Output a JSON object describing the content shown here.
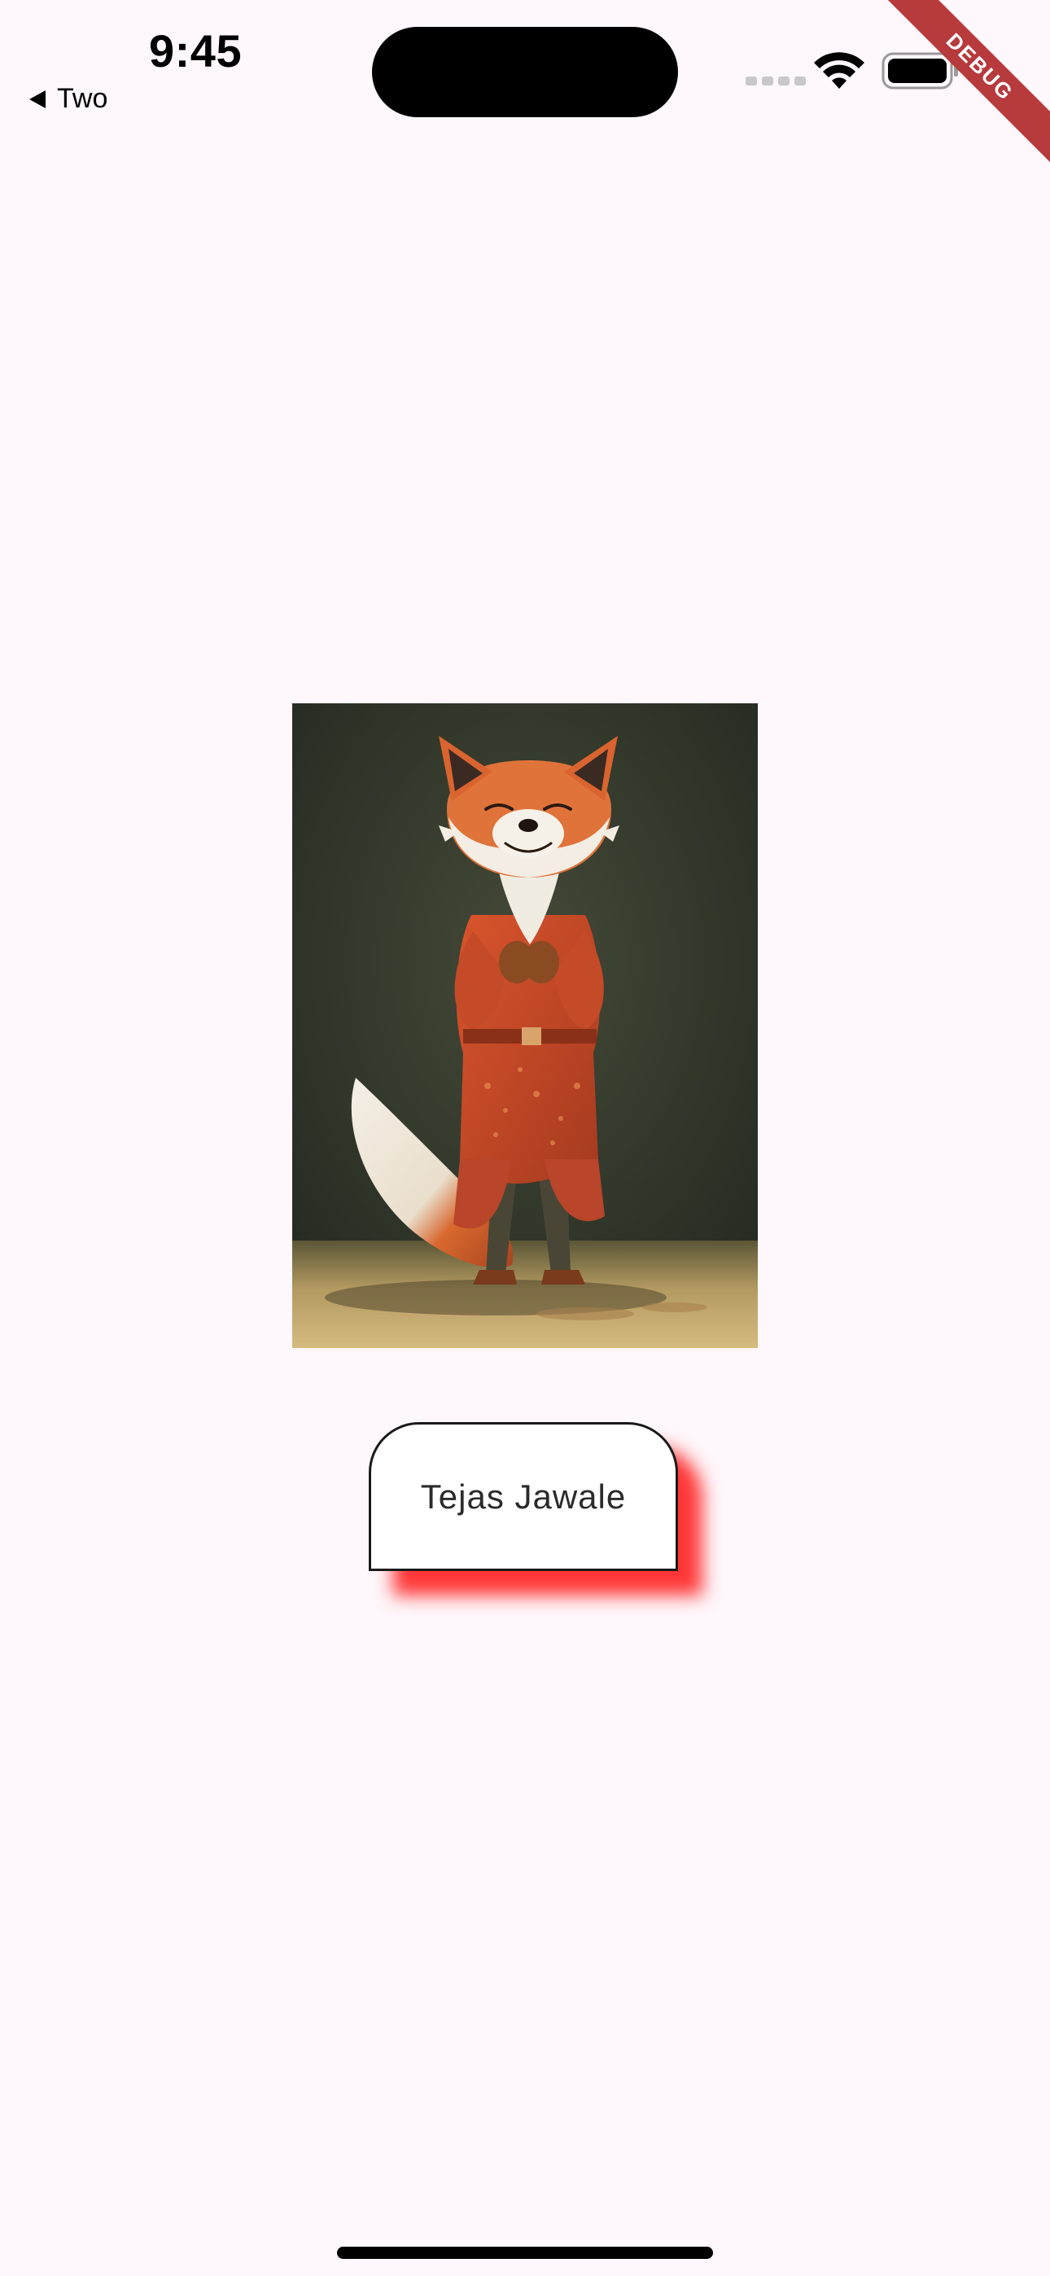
{
  "status_bar": {
    "time": "9:45",
    "back_label": "Two"
  },
  "debug_banner": {
    "label": "DEBUG"
  },
  "main": {
    "image": {
      "subject": "fox-character-illustration"
    },
    "name_button": {
      "label": "Tejas Jawale"
    }
  },
  "colors": {
    "background": "#fef7fb",
    "button_shadow": "#ff1414",
    "debug_banner": "#b73a3c"
  }
}
